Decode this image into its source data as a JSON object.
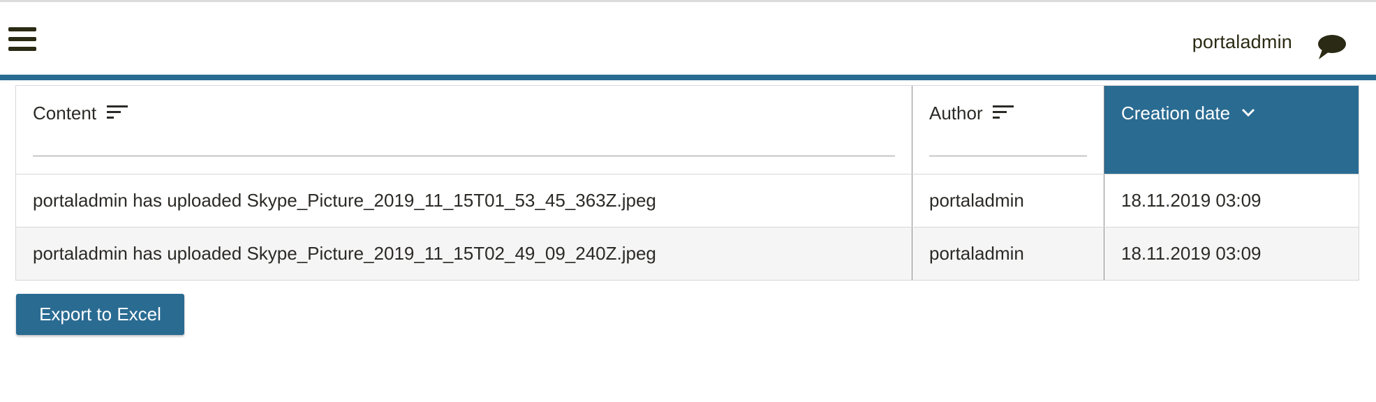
{
  "header": {
    "user_name": "portaladmin",
    "menu_icon": "hamburger-menu-icon",
    "chat_icon": "speech-bubble-icon",
    "accent_color": "#2a6b92"
  },
  "table": {
    "columns": [
      {
        "label": "Content",
        "sort": "none"
      },
      {
        "label": "Author",
        "sort": "none"
      },
      {
        "label": "Creation date",
        "sort": "descending",
        "active": true
      }
    ],
    "rows": [
      {
        "content": "portaladmin has uploaded Skype_Picture_2019_11_15T01_53_45_363Z.jpeg",
        "author": "portaladmin",
        "date": "18.11.2019 03:09"
      },
      {
        "content": "portaladmin has uploaded Skype_Picture_2019_11_15T02_49_09_240Z.jpeg",
        "author": "portaladmin",
        "date": "18.11.2019 03:09"
      }
    ]
  },
  "actions": {
    "export_label": "Export to Excel"
  }
}
